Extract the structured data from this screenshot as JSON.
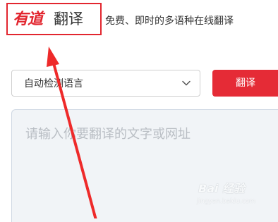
{
  "header": {
    "logo_brand": "有道",
    "logo_product": "翻译",
    "tagline": "免费、即时的多语种在线翻译"
  },
  "toolbar": {
    "language_select": "自动检测语言",
    "translate_label": "翻译"
  },
  "source": {
    "placeholder": "请输入你要翻译的文字或网址"
  },
  "watermark": {
    "logo": "Bai 经验",
    "url": "jingyan.baidu.com"
  },
  "colors": {
    "brand_red": "#e2262f",
    "button_red": "#e52b36",
    "input_bg": "#f1f4f7",
    "annotation_red": "#ee2a2a"
  },
  "icons": {
    "select_arrow": "chevron-down-icon",
    "annotation": "arrow-icon"
  }
}
